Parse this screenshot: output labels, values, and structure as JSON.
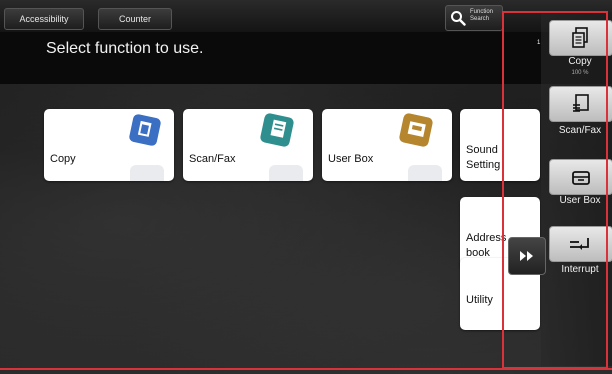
{
  "topbar": {
    "accessibility_label": "Accessibility",
    "counter_label": "Counter",
    "function_search_label": "Function\nSearch"
  },
  "header": {
    "title": "Select function to use."
  },
  "tiles": {
    "copy": "Copy",
    "scan_fax": "Scan/Fax",
    "user_box": "User Box",
    "sound_setting": "Sound\nSetting",
    "address_book": "Address\nbook",
    "utility": "Utility"
  },
  "side_panel": {
    "counter_hint": "1",
    "copy_label": "Copy",
    "copy_sub": "100 %",
    "scan_fax_label": "Scan/Fax",
    "user_box_label": "User Box",
    "interrupt_label": "Interrupt"
  },
  "colors": {
    "highlight": "#d9323a",
    "copy_icon": "#3a6fc4",
    "scan_icon": "#2f8f8f",
    "box_icon": "#b5862e"
  },
  "icons": {
    "copy": "copy-icon",
    "scan": "scan-icon",
    "box": "user-box-icon",
    "search": "search-icon",
    "expand": "double-chevron-right-icon",
    "interrupt": "interrupt-icon"
  }
}
